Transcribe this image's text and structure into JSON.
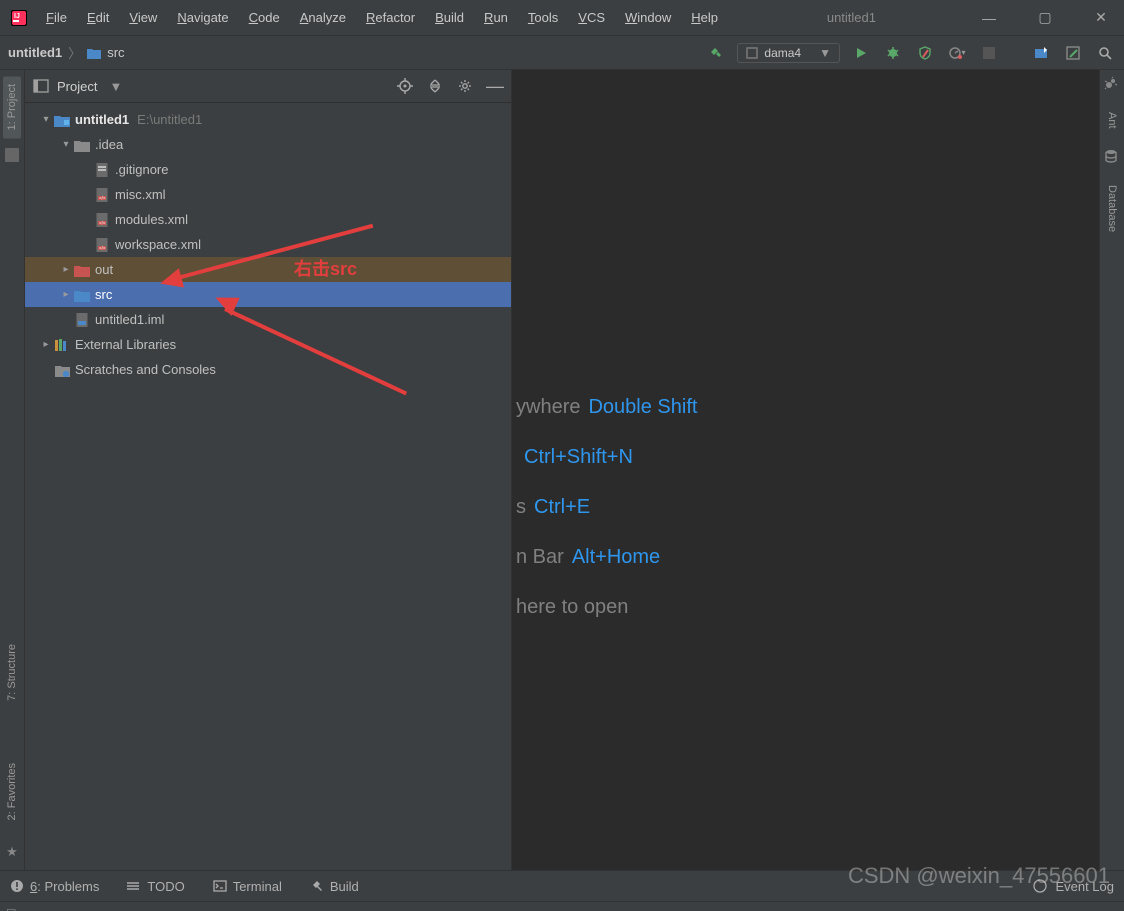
{
  "app": {
    "title": "untitled1"
  },
  "menubar": [
    "File",
    "Edit",
    "View",
    "Navigate",
    "Code",
    "Analyze",
    "Refactor",
    "Build",
    "Run",
    "Tools",
    "VCS",
    "Window",
    "Help"
  ],
  "breadcrumb": [
    {
      "label": "untitled1",
      "type": "module"
    },
    {
      "label": "src",
      "type": "folder"
    }
  ],
  "runconfig": {
    "name": "dama4"
  },
  "project_panel": {
    "title": "Project",
    "tree": [
      {
        "depth": 0,
        "arrow": "down",
        "icon": "module",
        "label": "untitled1",
        "hint": "E:\\untitled1",
        "bold": true,
        "state": ""
      },
      {
        "depth": 1,
        "arrow": "down",
        "icon": "folder",
        "label": ".idea",
        "state": ""
      },
      {
        "depth": 2,
        "arrow": "",
        "icon": "gitignore",
        "label": ".gitignore",
        "state": ""
      },
      {
        "depth": 2,
        "arrow": "",
        "icon": "xml",
        "label": "misc.xml",
        "state": ""
      },
      {
        "depth": 2,
        "arrow": "",
        "icon": "xml",
        "label": "modules.xml",
        "state": ""
      },
      {
        "depth": 2,
        "arrow": "",
        "icon": "xml",
        "label": "workspace.xml",
        "state": ""
      },
      {
        "depth": 1,
        "arrow": "right",
        "icon": "folder-red",
        "label": "out",
        "state": "hov"
      },
      {
        "depth": 1,
        "arrow": "right",
        "icon": "folder-blue",
        "label": "src",
        "state": "sel"
      },
      {
        "depth": 1,
        "arrow": "",
        "icon": "iml",
        "label": "untitled1.iml",
        "state": ""
      },
      {
        "depth": 0,
        "arrow": "right",
        "icon": "libs",
        "label": "External Libraries",
        "state": ""
      },
      {
        "depth": 0,
        "arrow": "",
        "icon": "scratch",
        "label": "Scratches and Consoles",
        "state": ""
      }
    ],
    "annotation": "右击src"
  },
  "welcome": [
    {
      "text": "ywhere",
      "key": "Double Shift"
    },
    {
      "text": "",
      "key": "Ctrl+Shift+N"
    },
    {
      "text": "s",
      "key": "Ctrl+E"
    },
    {
      "text": "n Bar",
      "key": "Alt+Home"
    },
    {
      "text": "here to open",
      "key": ""
    }
  ],
  "leftgutter": [
    {
      "label": "1: Project",
      "selected": true
    },
    {
      "label": "7: Structure",
      "selected": false
    },
    {
      "label": "2: Favorites",
      "selected": false
    }
  ],
  "rightgutter": [
    {
      "label": "Ant"
    },
    {
      "label": "Database"
    }
  ],
  "statusbar": {
    "items": [
      {
        "icon": "warn",
        "label": "6: Problems",
        "u": "6"
      },
      {
        "icon": "todo",
        "label": "TODO"
      },
      {
        "icon": "terminal",
        "label": "Terminal"
      },
      {
        "icon": "hammer",
        "label": "Build"
      }
    ],
    "right": {
      "label": "Event Log"
    }
  },
  "watermark": "CSDN @weixin_47556601"
}
